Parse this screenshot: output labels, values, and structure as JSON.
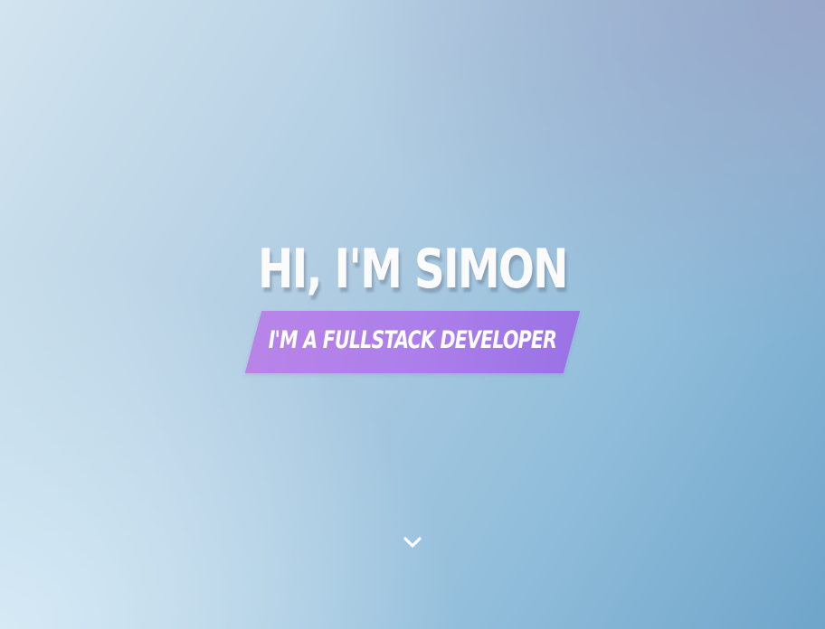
{
  "hero": {
    "title": "HI, I'M SIMON",
    "tagline": "I'M A FULLSTACK DEVELOPER"
  },
  "scroll_indicator": {
    "icon": "chevron-down-icon"
  },
  "colors": {
    "title_text": "#fbfbfb",
    "banner_start": "#b884e8",
    "banner_end": "#9b73e6",
    "background_light": "#d2e4ef",
    "background_dark": "#6fa5ca"
  }
}
